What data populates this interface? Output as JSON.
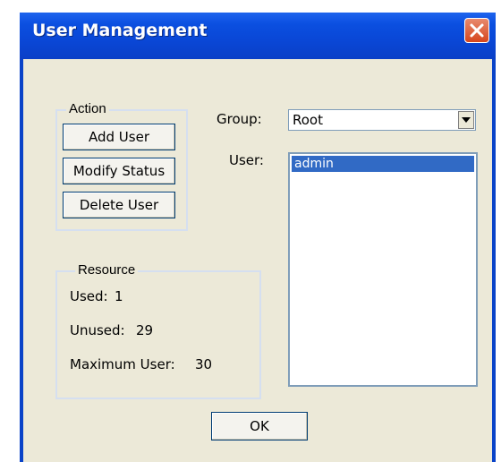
{
  "window": {
    "title": "User Management"
  },
  "action": {
    "legend": "Action",
    "add_user": "Add User",
    "modify_status": "Modify Status",
    "delete_user": "Delete User"
  },
  "resource": {
    "legend": "Resource",
    "used_label": "Used:",
    "used_value": "1",
    "unused_label": "Unused:",
    "unused_value": "29",
    "maximum_label": "Maximum User:",
    "maximum_value": "30"
  },
  "group": {
    "label": "Group:",
    "selected": "Root"
  },
  "user": {
    "label": "User:",
    "items": [
      "admin"
    ]
  },
  "footer": {
    "ok_label": "OK"
  },
  "colors": {
    "titlebar": "#0a47d6",
    "client_bg": "#ece9d8",
    "selection": "#316ac5",
    "close_button": "#d6461d"
  }
}
